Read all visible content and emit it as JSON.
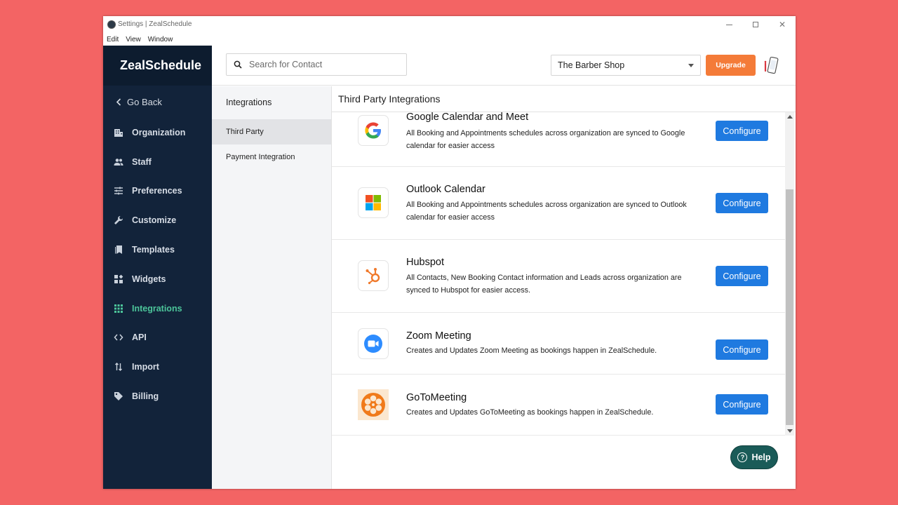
{
  "window": {
    "title": "Settings | ZealSchedule"
  },
  "menu": [
    "Edit",
    "View",
    "Window"
  ],
  "brand": "ZealSchedule",
  "go_back": "Go Back",
  "nav": [
    {
      "label": "Organization",
      "icon": "building-icon"
    },
    {
      "label": "Staff",
      "icon": "people-icon"
    },
    {
      "label": "Preferences",
      "icon": "sliders-icon"
    },
    {
      "label": "Customize",
      "icon": "wrench-icon"
    },
    {
      "label": "Templates",
      "icon": "bookmark-icon"
    },
    {
      "label": "Widgets",
      "icon": "widgets-icon"
    },
    {
      "label": "Integrations",
      "icon": "grid-icon",
      "active": true
    },
    {
      "label": "API",
      "icon": "code-icon"
    },
    {
      "label": "Import",
      "icon": "import-arrows-icon"
    },
    {
      "label": "Billing",
      "icon": "tag-icon"
    }
  ],
  "search": {
    "placeholder": "Search for Contact"
  },
  "shop": {
    "selected": "The Barber Shop"
  },
  "upgrade_label": "Upgrade",
  "subnav": {
    "title": "Integrations",
    "items": [
      {
        "label": "Third Party",
        "active": true
      },
      {
        "label": "Payment Integration"
      }
    ]
  },
  "main": {
    "title": "Third Party Integrations",
    "configure_label": "Configure",
    "integrations": [
      {
        "name": "Google Calendar and Meet",
        "desc": "All Booking and Appointments schedules across organization are synced to Google calendar for easier access",
        "logo": "google-logo"
      },
      {
        "name": "Outlook Calendar",
        "desc": "All Booking and Appointments schedules across organization are synced to Outlook calendar for easier access",
        "logo": "microsoft-logo"
      },
      {
        "name": "Hubspot",
        "desc": "All Contacts, New Booking Contact information and Leads across organization are synced to Hubspot for easier access.",
        "logo": "hubspot-logo"
      },
      {
        "name": "Zoom Meeting",
        "desc": "Creates and Updates Zoom Meeting as bookings happen in ZealSchedule.",
        "logo": "zoom-logo"
      },
      {
        "name": "GoToMeeting",
        "desc": "Creates and Updates GoToMeeting as bookings happen in ZealSchedule.",
        "logo": "gotomeeting-logo"
      }
    ]
  },
  "help_label": "Help",
  "colors": {
    "page_background": "#f36464",
    "sidebar": "#12233a",
    "active_nav": "#4cc59a",
    "upgrade": "#f47b38",
    "configure": "#1f7ae0",
    "help": "#1a5b58"
  }
}
